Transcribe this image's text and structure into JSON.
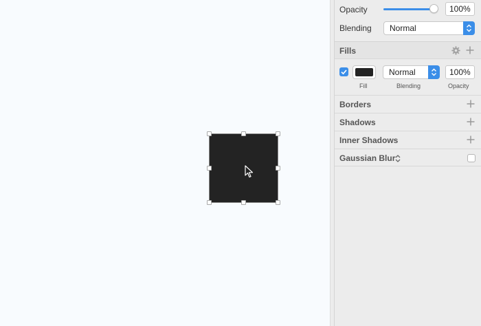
{
  "layer": {
    "opacity_label": "Opacity",
    "opacity_value": "100%",
    "opacity_fraction": 1.0,
    "blending_label": "Blending",
    "blending_value": "Normal"
  },
  "fills": {
    "title": "Fills",
    "enabled": true,
    "swatch_color": "#232323",
    "blending_value": "Normal",
    "opacity_value": "100%",
    "sub_labels": {
      "fill": "Fill",
      "blending": "Blending",
      "opacity": "Opacity"
    }
  },
  "sections": {
    "borders": "Borders",
    "shadows": "Shadows",
    "inner_shadows": "Inner Shadows",
    "gaussian_blur": "Gaussian Blur"
  },
  "colors": {
    "accent": "#3b8ee8",
    "canvas": "#f8fbfe",
    "panel": "#ececec",
    "shape": "#232323"
  },
  "icons": [
    "gear-icon",
    "plus-icon",
    "chevron-updown-icon",
    "checkbox-icon",
    "cursor-icon"
  ]
}
